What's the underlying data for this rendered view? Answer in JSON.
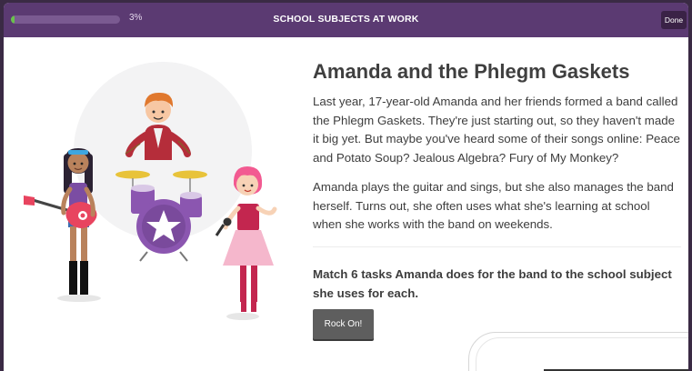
{
  "header": {
    "progress_percent": 3,
    "progress_text": "3%",
    "title": "SCHOOL SUBJECTS AT WORK",
    "done_label": "Done"
  },
  "main": {
    "title": "Amanda and the Phlegm Gaskets",
    "paragraph_1": "Last year, 17-year-old Amanda and her friends formed a band called the Phlegm Gaskets. They're just starting out, so they haven't made it big yet. But maybe you've heard some of their songs online: Peace and Potato Soup? Jealous Algebra? Fury of My Monkey?",
    "paragraph_2": "Amanda plays the guitar and sings, but she also manages the band herself. Turns out, she often uses what she's learning at school when she works with the band on weekends.",
    "prompt": "Match 6 tasks Amanda does for the band to the school subject she uses for each.",
    "button_label": "Rock On!"
  },
  "colors": {
    "header_bg": "#5b3a72",
    "progress_fill": "#69c24b",
    "button_bg": "#5e5e5e"
  }
}
